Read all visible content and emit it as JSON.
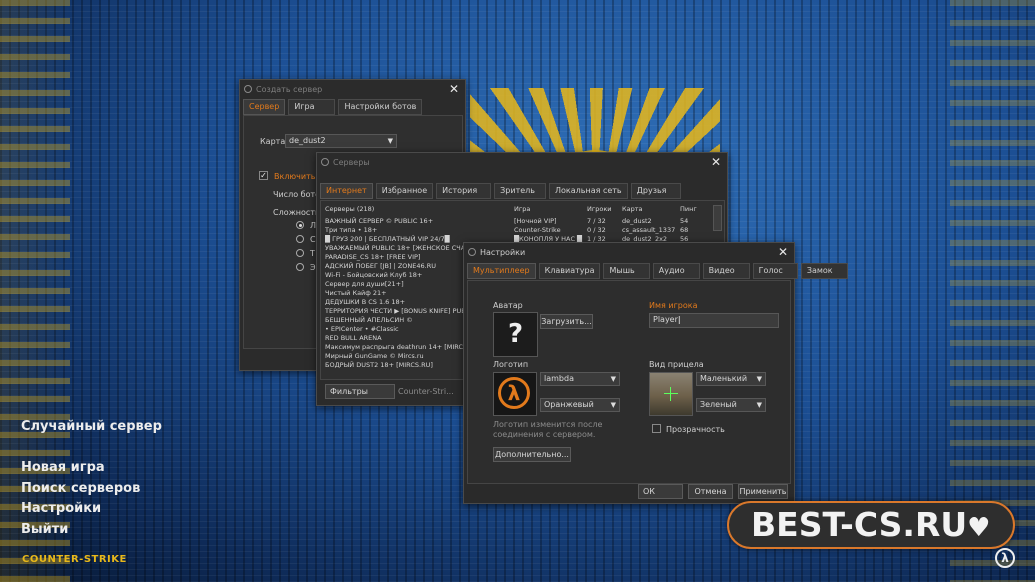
{
  "create_server": {
    "title": "Создать сервер",
    "tabs": [
      "Сервер",
      "Игра",
      "Настройки ботов"
    ],
    "map_label": "Карта",
    "map_value": "de_dust2",
    "enable_bots_label": "Включить б",
    "bot_count_label": "Число бото",
    "difficulty_label": "Сложность",
    "radio_labels": [
      "Л",
      "С",
      "Т",
      "Э"
    ]
  },
  "servers": {
    "title": "Серверы",
    "tabs": [
      "Интернет",
      "Избранное",
      "История",
      "Зритель",
      "Локальная сеть",
      "Друзья"
    ],
    "columns": [
      "Серверы (218)",
      "Игра",
      "Игроки",
      "Карта",
      "Пинг"
    ],
    "rows": [
      [
        "ВАЖНЫЙ СЕРВЕР © PUBLIC 16+",
        "[Ночной VIP]",
        "7 / 32",
        "de_dust2",
        "54"
      ],
      [
        "Три типа • 18+",
        "Counter-Strike",
        "0 / 32",
        "cs_assault_1337",
        "68"
      ],
      [
        "█ ГРУЗ 200 | БЕСПЛАТНЫЙ VIP 24/7█",
        "█КОНОПЛЯ У НАС █",
        "1 / 32",
        "de_dust2_2x2",
        "56"
      ],
      [
        "УВАЖАЕМЫЙ PUBLIC 18+ [ЖЕНСКОЕ СЧАСТ",
        "",
        "",
        "",
        ""
      ],
      [
        "PARADISE_CS 18+ [FREE VIP]",
        "",
        "",
        "",
        ""
      ],
      [
        "АДСКИЙ ПОБЕГ [JB] | ZONE46.RU",
        "",
        "",
        "",
        ""
      ],
      [
        "Wi-Fi - Бойцовский Клуб 18+",
        "",
        "",
        "",
        ""
      ],
      [
        "Сервер для души[21+]",
        "",
        "",
        "",
        ""
      ],
      [
        "Чистый Кайф 21+",
        "",
        "",
        "",
        ""
      ],
      [
        "ДЕДУШКИ В CS 1.6 18+",
        "",
        "",
        "",
        ""
      ],
      [
        "ТЕРРИТОРИЯ ЧЕСТИ ▶ [BONUS KNIFE] PUBL",
        "",
        "",
        "",
        ""
      ],
      [
        "БЕШЕННЫЙ АПЕЛЬСИН ©",
        "",
        "",
        "",
        ""
      ],
      [
        "• EPICenter • #Classic",
        "",
        "",
        "",
        ""
      ],
      [
        "RED BULL ARENA",
        "",
        "",
        "",
        ""
      ],
      [
        "Максимум распрыга deathrun 14+ [MIRCS.RU]",
        "",
        "",
        "",
        ""
      ],
      [
        "Мирный GunGame © Mircs.ru",
        "",
        "",
        "",
        ""
      ],
      [
        "БОДРЫЙ DUST2 18+ [MIRCS.RU]",
        "",
        "",
        "",
        ""
      ]
    ],
    "filters_label": "Фильтры",
    "filter_game": "Counter-Stri..."
  },
  "settings": {
    "title": "Настройки",
    "tabs": [
      "Мультиплеер",
      "Клавиатура",
      "Мышь",
      "Аудио",
      "Видео",
      "Голос",
      "Замок"
    ],
    "avatar_label": "Аватар",
    "avatar_placeholder": "?",
    "upload_button": "Загрузить...",
    "player_name_label": "Имя игрока",
    "player_name_value": "Player",
    "logo_label": "Логотип",
    "logo_value": "lambda",
    "logo_color": "Оранжевый",
    "crosshair_label": "Вид прицела",
    "crosshair_size": "Маленький",
    "crosshair_color": "Зеленый",
    "transparency_label": "Прозрачность",
    "logo_note": "Логотип изменится после соединения с сервером.",
    "advanced_button": "Дополнительно...",
    "ok_button": "ОК",
    "cancel_button": "Отмена",
    "apply_button": "Применить"
  },
  "main_menu": {
    "random_server": "Случайный сервер",
    "items": [
      "Новая игра",
      "Поиск серверов",
      "Настройки",
      "Выйти"
    ],
    "logo_text": "COUNTER-STRIKE"
  },
  "watermark": {
    "text": "BEST-CS.RU",
    "heart": "♥"
  },
  "colors": {
    "accent": "#e27a1c",
    "window_bg": "#2b2b2b",
    "badge_border": "#d9782b"
  }
}
